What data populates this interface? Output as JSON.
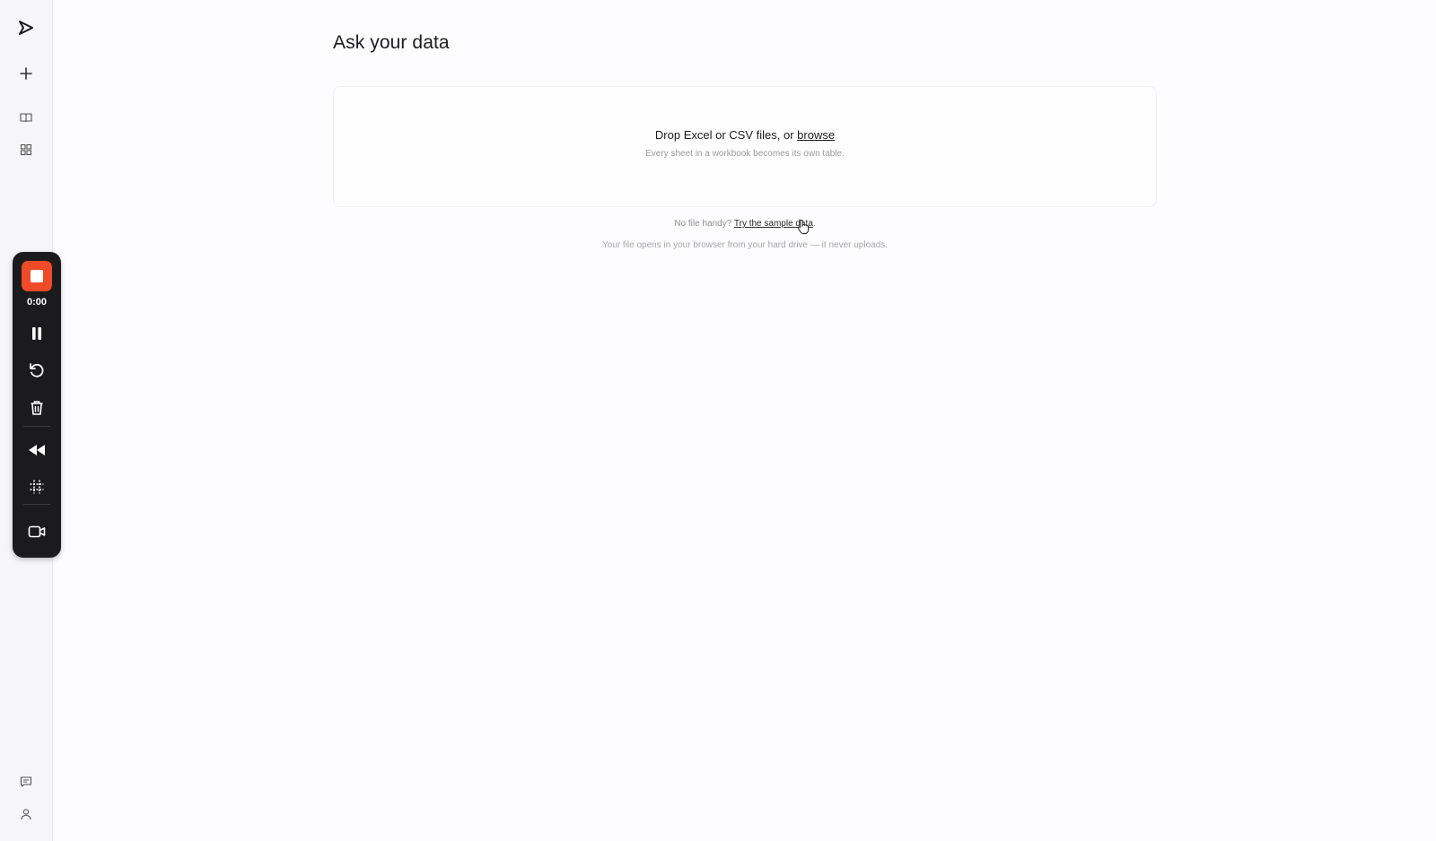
{
  "nav": {
    "items": [
      {
        "name": "send",
        "icon": "send-arrow-icon"
      },
      {
        "name": "new",
        "icon": "plus-icon"
      },
      {
        "name": "book",
        "icon": "book-open-icon"
      },
      {
        "name": "grid",
        "icon": "grid-icon"
      }
    ],
    "bottom": [
      {
        "name": "feedback",
        "icon": "message-icon"
      },
      {
        "name": "account",
        "icon": "user-icon"
      }
    ]
  },
  "recorder": {
    "time": "0:00",
    "accent": "#ef4b28"
  },
  "main": {
    "title": "Ask your data",
    "dropzone": {
      "prompt": "Drop Excel or CSV files, or",
      "browse_link": "browse",
      "hint": "Every sheet in a workbook becomes its own table."
    },
    "sample": {
      "prefix": "No file handy?",
      "link": "Try the sample data",
      "suffix": "."
    },
    "privacy_note": "Your file opens in your browser from your hard drive — it never uploads."
  }
}
